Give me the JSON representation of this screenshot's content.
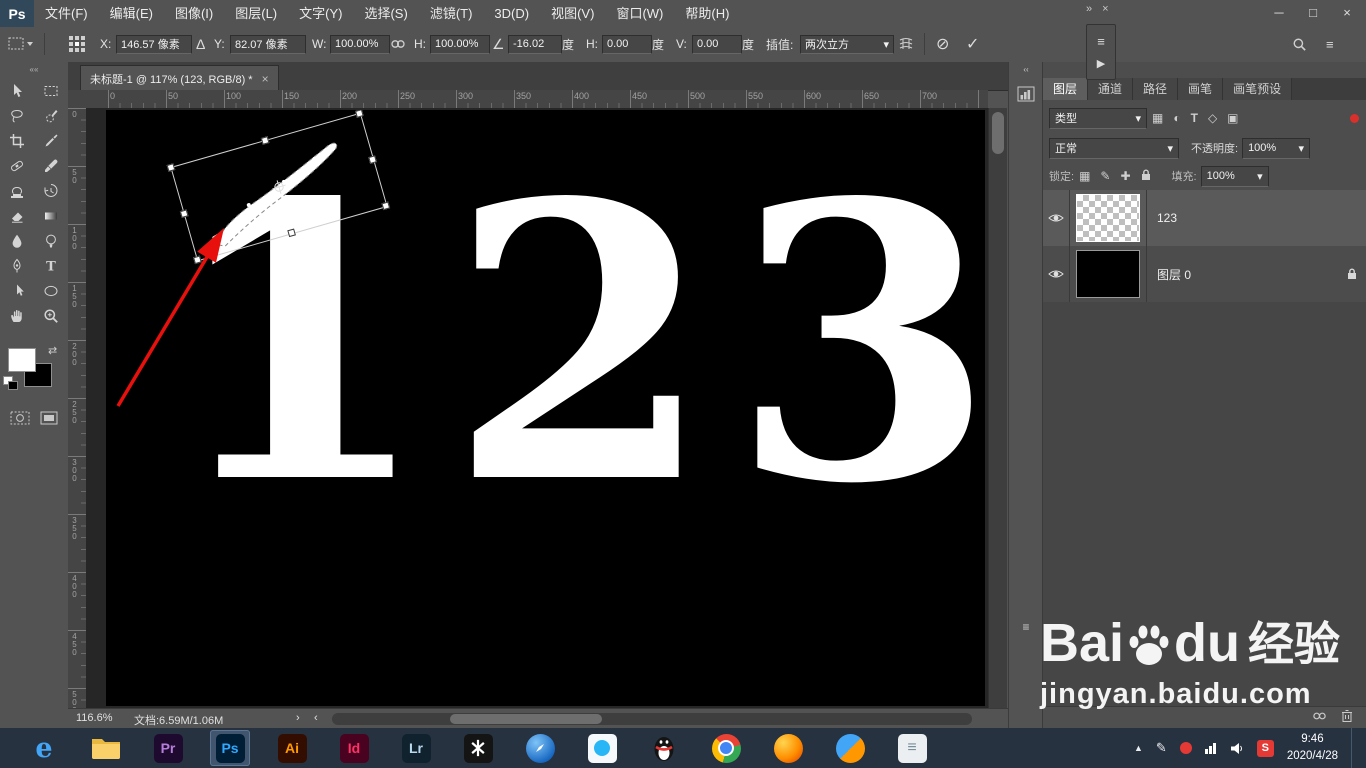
{
  "app": {
    "logo": "Ps"
  },
  "menu_bar": {
    "items": [
      "文件(F)",
      "编辑(E)",
      "图像(I)",
      "图层(L)",
      "文字(Y)",
      "选择(S)",
      "滤镜(T)",
      "3D(D)",
      "视图(V)",
      "窗口(W)",
      "帮助(H)"
    ]
  },
  "window_controls": {
    "minimize": "─",
    "restore": "□",
    "close": "×",
    "dock_collapse": "»",
    "dock_close": "×"
  },
  "options_bar": {
    "x_label": "X:",
    "x_value": "146.57 像素",
    "delta": "Δ",
    "y_label": "Y:",
    "y_value": "82.07 像素",
    "w_label": "W:",
    "w_value": "100.00%",
    "h_label": "H:",
    "h_value": "100.00%",
    "angle_value": "-16.02",
    "deg_unit": "度",
    "h_skew_label": "H:",
    "h_skew_value": "0.00",
    "v_skew_label": "V:",
    "v_skew_value": "0.00",
    "interp_label": "插值:",
    "interp_value": "两次立方",
    "cancel_glyph": "⊘",
    "commit_glyph": "✓"
  },
  "document": {
    "tab_title": "未标题-1 @ 117% (123, RGB/8) *",
    "tab_close": "×",
    "canvas_text": "123",
    "zoom_level": "116.6%",
    "doc_info": "文档:6.59M/1.06M"
  },
  "rulers": {
    "top": [
      "0",
      "50",
      "100",
      "150",
      "200",
      "250",
      "300",
      "350",
      "400",
      "450",
      "500",
      "550",
      "600",
      "650",
      "700"
    ],
    "left": [
      "0",
      "50",
      "100",
      "150",
      "200",
      "250",
      "300",
      "350",
      "400",
      "450",
      "500"
    ]
  },
  "toolbar": {
    "tools": [
      "move",
      "rectangular-marquee",
      "lasso",
      "quick-selection",
      "crop",
      "eyedropper",
      "spot-healing-brush",
      "brush",
      "clone-stamp",
      "history-brush",
      "eraser",
      "gradient",
      "blur",
      "dodge",
      "pen",
      "horizontal-type",
      "path-selection",
      "ellipse-shape",
      "hand",
      "zoom"
    ],
    "foreground_color": "#ffffff",
    "background_color": "#000000"
  },
  "panels": {
    "tabs": [
      "图层",
      "通道",
      "路径",
      "画笔",
      "画笔预设"
    ],
    "active_tab": "图层",
    "filter_kind_label": "类型",
    "blend_mode": "正常",
    "opacity_label": "不透明度:",
    "opacity_value": "100%",
    "lock_label": "锁定:",
    "fill_label": "填充:",
    "fill_value": "100%",
    "layers": [
      {
        "name": "123",
        "selected": true
      },
      {
        "name": "图层 0",
        "locked": true
      }
    ]
  },
  "watermark": {
    "brand_left": "Bai",
    "brand_right": "du",
    "brand_cn": "经验",
    "url": "jingyan.baidu.com"
  },
  "taskbar": {
    "apps": [
      {
        "name": "internet-explorer",
        "glyph": "e"
      },
      {
        "name": "file-explorer",
        "glyph": ""
      },
      {
        "name": "premiere",
        "glyph": "Pr"
      },
      {
        "name": "photoshop",
        "glyph": "Ps",
        "active": true
      },
      {
        "name": "illustrator",
        "glyph": "Ai"
      },
      {
        "name": "indesign",
        "glyph": "Id"
      },
      {
        "name": "lightroom",
        "glyph": "Lr"
      },
      {
        "name": "video-editor",
        "glyph": ""
      },
      {
        "name": "compass-browser",
        "glyph": ""
      },
      {
        "name": "messenger",
        "glyph": ""
      },
      {
        "name": "qq",
        "glyph": ""
      },
      {
        "name": "chrome",
        "glyph": ""
      },
      {
        "name": "firefox",
        "glyph": ""
      },
      {
        "name": "sphere-app",
        "glyph": ""
      },
      {
        "name": "notes",
        "glyph": "≡"
      }
    ],
    "tray_input_badge": "S",
    "time": "9:46",
    "date": "2020/4/28"
  },
  "transform": {
    "rotation_deg": -16.02
  },
  "ui": {
    "caret": "▾",
    "collapse_left": "««",
    "collapse_right": "‹‹",
    "chevron_right": "›",
    "chevron_left": "‹",
    "list_glyph": "≡",
    "play_glyph": "▶",
    "swap_glyph": "⇄",
    "angle_glyph": "∠",
    "tray_chevron": "▲",
    "pencil": "✎"
  },
  "colors": {
    "arrow": "#e8100c",
    "ui_bg": "#535353",
    "canvas_bg": "#000000",
    "taskbar_bg": "#273240",
    "ps_accent": "#31a8ff"
  }
}
